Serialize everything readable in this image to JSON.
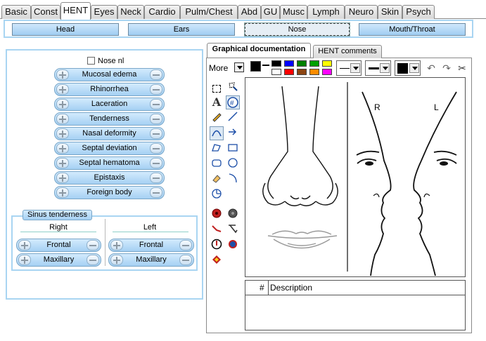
{
  "tabs": [
    "Basic",
    "Const",
    "HENT",
    "Eyes",
    "Neck",
    "Cardio",
    "Pulm/Chest",
    "Abd",
    "GU",
    "Musc",
    "Lymph",
    "Neuro",
    "Skin",
    "Psych"
  ],
  "active_tab": "HENT",
  "subtabs": [
    "Head",
    "Ears",
    "Nose",
    "Mouth/Throat"
  ],
  "active_subtab": "Nose",
  "nose": {
    "normal_label": "Nose nl",
    "findings": [
      "Mucosal edema",
      "Rhinorrhea",
      "Laceration",
      "Tenderness",
      "Nasal deformity",
      "Septal deviation",
      "Septal hematoma",
      "Epistaxis",
      "Foreign body"
    ]
  },
  "sinus": {
    "title": "Sinus tenderness",
    "right_label": "Right",
    "left_label": "Left",
    "right_items": [
      "Frontal",
      "Maxillary"
    ],
    "left_items": [
      "Frontal",
      "Maxillary"
    ]
  },
  "right_tabs": [
    "Graphical documentation",
    "HENT comments"
  ],
  "toolbar": {
    "more_label": "More",
    "palette": [
      "#000000",
      "#0000ff",
      "#008000",
      "#ffff00",
      "#ffffff",
      "#ff0000",
      "#8b4513",
      "#ff8c00",
      "#ff00ff"
    ],
    "current_color": "#000000"
  },
  "tools": [
    "select-icon",
    "lasso-icon",
    "text-icon",
    "number-icon",
    "pencil-icon",
    "line-icon",
    "arc-icon",
    "arrow-icon",
    "polygon-icon",
    "rectangle-icon",
    "rounded-rect-icon",
    "ellipse-icon",
    "eraser-icon",
    "curve-icon",
    "pie-icon",
    "red-stamp-icon",
    "gray-stamp-icon",
    "red-line-icon",
    "gray-line-icon",
    "clock-icon",
    "blue-shape-icon",
    "yellow-shape-icon"
  ],
  "drawing": {
    "right_side_label": "R",
    "left_side_label": "L"
  },
  "description_table": {
    "number_header": "#",
    "text_header": "Description"
  }
}
